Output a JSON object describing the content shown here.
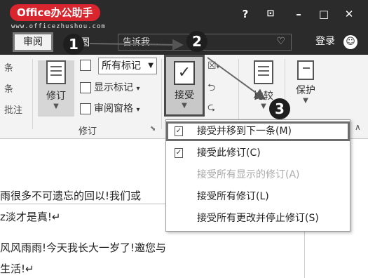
{
  "app": {
    "logo_text": "Office办公助手",
    "logo_url": "www.officezhushou.com"
  },
  "window_controls": {
    "help": "?",
    "restore_ribbon": "⊡",
    "minimize": "–",
    "maximize": "□",
    "close": "✕"
  },
  "tabs": {
    "review": "审阅",
    "view_partial": "图"
  },
  "search": {
    "placeholder": "告诉我..."
  },
  "account": {
    "login": "登录"
  },
  "ribbon": {
    "left_stub": [
      "条",
      "条",
      "批注"
    ],
    "track_changes": {
      "label": "修订",
      "markup_select": "所有标记",
      "show_markup": "显示标记",
      "review_pane": "审阅窗格",
      "group_label": "修订"
    },
    "accept": {
      "label": "接受"
    },
    "compare": {
      "label": "比较"
    },
    "protect": {
      "label": "保护"
    }
  },
  "accept_menu": {
    "items": [
      {
        "label": "接受并移到下一条(M)",
        "enabled": true,
        "highlighted": true
      },
      {
        "label": "接受此修订(C)",
        "enabled": true,
        "highlighted": false
      },
      {
        "label": "接受所有显示的修订(A)",
        "enabled": false,
        "highlighted": false
      },
      {
        "label": "接受所有修订(L)",
        "enabled": true,
        "highlighted": false
      },
      {
        "label": "接受所有更改并停止修订(S)",
        "enabled": true,
        "highlighted": false
      }
    ]
  },
  "document": {
    "lines": [
      "雨很多不可遗忘的回以!我们或",
      "z淡才是真!↵",
      "风风雨雨!今天我长大一岁了!邀您与",
      "生活!↵"
    ]
  },
  "callouts": [
    "1",
    "2",
    "3"
  ],
  "colors": {
    "logo_bg": "#d9262e",
    "titlebar_bg": "#2b2b2b",
    "ribbon_bg": "#f3f3f3",
    "highlight_border": "#4a4a4a"
  }
}
